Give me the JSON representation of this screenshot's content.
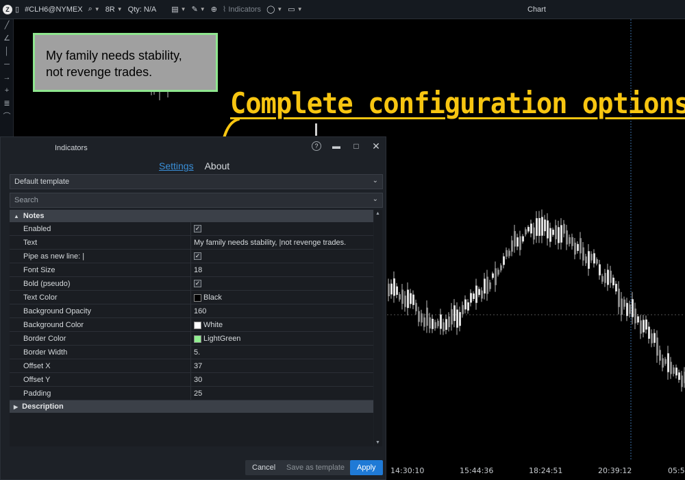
{
  "topbar": {
    "symbol": "#CLH6@NYMEX",
    "bar_type": "8R",
    "qty": "Qty: N/A",
    "indicators_label": "Indicators",
    "chart_title": "Chart"
  },
  "note": {
    "line1": "My family needs stability,",
    "line2": "not revenge trades."
  },
  "headline": "Complete configuration options",
  "dialog": {
    "title": "Indicators",
    "tabs": {
      "settings": "Settings",
      "about": "About"
    },
    "template_select": "Default template",
    "search_placeholder": "Search",
    "section_notes": "Notes",
    "section_description": "Description",
    "properties": [
      {
        "name": "Enabled",
        "value": "",
        "kind": "check"
      },
      {
        "name": "Text",
        "value": "My family needs stability, |not revenge trades.",
        "kind": "text"
      },
      {
        "name": "Pipe as new line: |",
        "value": "",
        "kind": "check"
      },
      {
        "name": "Font Size",
        "value": "18",
        "kind": "text"
      },
      {
        "name": "Bold (pseudo)",
        "value": "",
        "kind": "check"
      },
      {
        "name": "Text Color",
        "value": "Black",
        "kind": "color",
        "color": "#000000"
      },
      {
        "name": "Background Opacity",
        "value": "160",
        "kind": "text"
      },
      {
        "name": "Background Color",
        "value": "White",
        "kind": "color",
        "color": "#ffffff"
      },
      {
        "name": "Border Color",
        "value": "LightGreen",
        "kind": "color",
        "color": "#90ee90"
      },
      {
        "name": "Border Width",
        "value": "5.",
        "kind": "text"
      },
      {
        "name": "Offset X",
        "value": "37",
        "kind": "text"
      },
      {
        "name": "Offset Y",
        "value": "30",
        "kind": "text"
      },
      {
        "name": "Padding",
        "value": "25",
        "kind": "text"
      }
    ],
    "buttons": {
      "cancel": "Cancel",
      "save_template": "Save as template",
      "apply": "Apply"
    }
  },
  "time_axis": [
    "14:30:10",
    "15:44:36",
    "18:24:51",
    "20:39:12",
    "05:5"
  ],
  "colors": {
    "headline": "#f7c511",
    "apply": "#1f7ad6",
    "note_border": "#90ee90"
  }
}
